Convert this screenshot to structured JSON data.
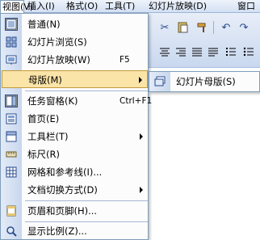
{
  "menubar": {
    "items": [
      "视图(V)",
      "插入(I)",
      "格式(O)",
      "工具(T)",
      "幻灯片放映(D)",
      "窗口"
    ]
  },
  "view_menu": {
    "items": [
      {
        "label": "普通(N)",
        "shortcut": "",
        "icon": "normal-view-icon",
        "checked": true
      },
      {
        "label": "幻灯片浏览(S)",
        "shortcut": "",
        "icon": "slide-sorter-icon"
      },
      {
        "label": "幻灯片放映(W)",
        "shortcut": "F5",
        "icon": "slideshow-icon"
      },
      {
        "label": "母版(M)",
        "shortcut": "",
        "icon": "",
        "submenu": true
      },
      {
        "label": "任务窗格(K)",
        "shortcut": "Ctrl+F1",
        "icon": "task-pane-icon",
        "checked": true
      },
      {
        "label": "首页(E)",
        "shortcut": "",
        "icon": "home-page-icon"
      },
      {
        "label": "工具栏(T)",
        "shortcut": "",
        "icon": "toolbar-icon",
        "submenu": true
      },
      {
        "label": "标尺(R)",
        "shortcut": "",
        "icon": "ruler-icon"
      },
      {
        "label": "网格和参考线(I)...",
        "shortcut": "",
        "icon": "grid-icon"
      },
      {
        "label": "文档切换方式(D)",
        "shortcut": "",
        "icon": "",
        "submenu": true
      },
      {
        "label": "页眉和页脚(H)...",
        "shortcut": "",
        "icon": "header-footer-icon"
      },
      {
        "label": "显示比例(Z)...",
        "shortcut": "",
        "icon": "zoom-icon"
      }
    ]
  },
  "master_submenu": {
    "items": [
      {
        "label": "幻灯片母版(S)",
        "icon": "slide-master-icon"
      }
    ]
  },
  "colors": {
    "highlight": "#fbe4a8",
    "menu_strip": "#c8d7ee",
    "border": "#7f9db9"
  }
}
